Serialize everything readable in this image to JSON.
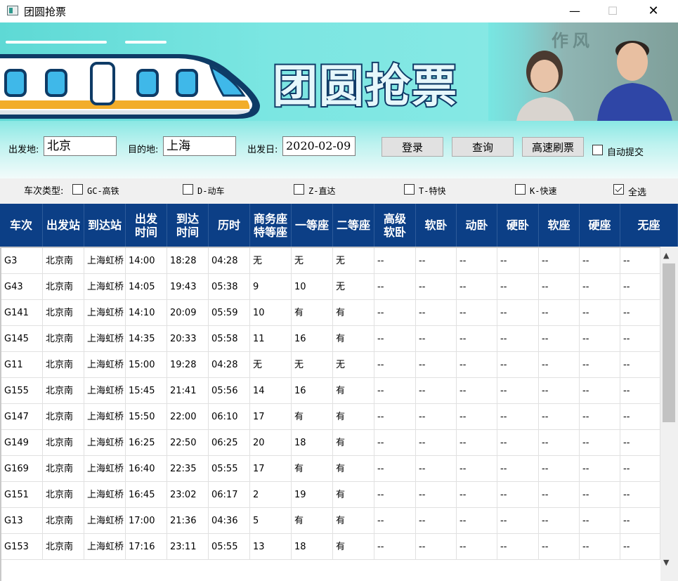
{
  "window": {
    "title": "团圆抢票",
    "min": "—",
    "max": "☐",
    "close": "✕"
  },
  "banner": {
    "title": "团圆抢票",
    "photo_sign": "作风"
  },
  "form": {
    "from_label": "出发地:",
    "from_value": "北京",
    "to_label": "目的地:",
    "to_value": "上海",
    "date_label": "出发日:",
    "date_value": "2020-02-09",
    "login_label": "登录",
    "query_label": "查询",
    "fast_label": "高速刷票",
    "auto_submit_label": "自动提交",
    "auto_submit_checked": false
  },
  "filters": {
    "label": "车次类型:",
    "types": [
      {
        "label": "GC-高铁",
        "checked": false
      },
      {
        "label": "D-动车",
        "checked": false
      },
      {
        "label": "Z-直达",
        "checked": false
      },
      {
        "label": "T-特快",
        "checked": false
      },
      {
        "label": "K-快速",
        "checked": false
      },
      {
        "label": "全选",
        "checked": true
      }
    ]
  },
  "table": {
    "headers": [
      "车次",
      "出发站",
      "到达站",
      "出发\n时间",
      "到达\n时间",
      "历时",
      "商务座\n特等座",
      "一等座",
      "二等座",
      "高级\n软卧",
      "软卧",
      "动卧",
      "硬卧",
      "软座",
      "硬座",
      "无座"
    ],
    "rows": [
      [
        "G3",
        "北京南",
        "上海虹桥",
        "14:00",
        "18:28",
        "04:28",
        "无",
        "无",
        "无",
        "--",
        "--",
        "--",
        "--",
        "--",
        "--",
        "--"
      ],
      [
        "G43",
        "北京南",
        "上海虹桥",
        "14:05",
        "19:43",
        "05:38",
        "9",
        "10",
        "无",
        "--",
        "--",
        "--",
        "--",
        "--",
        "--",
        "--"
      ],
      [
        "G141",
        "北京南",
        "上海虹桥",
        "14:10",
        "20:09",
        "05:59",
        "10",
        "有",
        "有",
        "--",
        "--",
        "--",
        "--",
        "--",
        "--",
        "--"
      ],
      [
        "G145",
        "北京南",
        "上海虹桥",
        "14:35",
        "20:33",
        "05:58",
        "11",
        "16",
        "有",
        "--",
        "--",
        "--",
        "--",
        "--",
        "--",
        "--"
      ],
      [
        "G11",
        "北京南",
        "上海虹桥",
        "15:00",
        "19:28",
        "04:28",
        "无",
        "无",
        "无",
        "--",
        "--",
        "--",
        "--",
        "--",
        "--",
        "--"
      ],
      [
        "G155",
        "北京南",
        "上海虹桥",
        "15:45",
        "21:41",
        "05:56",
        "14",
        "16",
        "有",
        "--",
        "--",
        "--",
        "--",
        "--",
        "--",
        "--"
      ],
      [
        "G147",
        "北京南",
        "上海虹桥",
        "15:50",
        "22:00",
        "06:10",
        "17",
        "有",
        "有",
        "--",
        "--",
        "--",
        "--",
        "--",
        "--",
        "--"
      ],
      [
        "G149",
        "北京南",
        "上海虹桥",
        "16:25",
        "22:50",
        "06:25",
        "20",
        "18",
        "有",
        "--",
        "--",
        "--",
        "--",
        "--",
        "--",
        "--"
      ],
      [
        "G169",
        "北京南",
        "上海虹桥",
        "16:40",
        "22:35",
        "05:55",
        "17",
        "有",
        "有",
        "--",
        "--",
        "--",
        "--",
        "--",
        "--",
        "--"
      ],
      [
        "G151",
        "北京南",
        "上海虹桥",
        "16:45",
        "23:02",
        "06:17",
        "2",
        "19",
        "有",
        "--",
        "--",
        "--",
        "--",
        "--",
        "--",
        "--"
      ],
      [
        "G13",
        "北京南",
        "上海虹桥",
        "17:00",
        "21:36",
        "04:36",
        "5",
        "有",
        "有",
        "--",
        "--",
        "--",
        "--",
        "--",
        "--",
        "--"
      ],
      [
        "G153",
        "北京南",
        "上海虹桥",
        "17:16",
        "23:11",
        "05:55",
        "13",
        "18",
        "有",
        "--",
        "--",
        "--",
        "--",
        "--",
        "--",
        "--"
      ]
    ]
  }
}
